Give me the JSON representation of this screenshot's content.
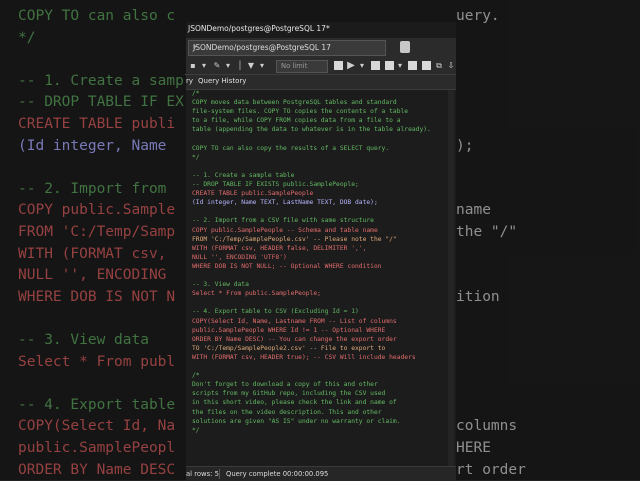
{
  "background_code": {
    "lines": [
      "COPY TO can also c",
      "*/",
      "",
      "-- 1. Create a sampl",
      "-- DROP TABLE IF EX",
      "CREATE TABLE publi",
      "(Id integer, Name ",
      "",
      "-- 2. Import from ",
      "COPY public.Sample",
      "FROM 'C:/Temp/Samp",
      "WITH (FORMAT csv, ",
      "NULL '', ENCODING ",
      "WHERE DOB IS NOT N",
      "",
      "-- 3. View data",
      "Select * From publ",
      "",
      "-- 4. Export table",
      "COPY(Select Id, Na",
      "public.SamplePeopl",
      "ORDER BY Name DESC"
    ],
    "right_lines": [
      "uery.",
      "",
      "",
      "",
      "",
      "",
      ");",
      "",
      "",
      "name",
      "the \"/\"",
      "",
      "",
      "ition",
      "",
      "",
      "",
      "",
      "",
      "columns",
      "HERE",
      "rt order"
    ]
  },
  "window": {
    "title": "JSONDemo/postgres@PostgreSQL 17*",
    "connection": "JSONDemo/postgres@PostgreSQL 17",
    "limit_placeholder": "No limit",
    "tabs": [
      "ry",
      "Query History"
    ]
  },
  "editor": {
    "lines": [
      {
        "text": "/*",
        "c": "g"
      },
      {
        "text": "COPY moves data between PostgreSQL tables and standard",
        "c": "g"
      },
      {
        "text": "file-system files. COPY TO copies the contents of a table",
        "c": "g"
      },
      {
        "text": "to a file, while COPY FROM copies data from a file to a",
        "c": "g"
      },
      {
        "text": "table (appending the data to whatever is in the table already).",
        "c": "g"
      },
      {
        "text": "",
        "c": "g"
      },
      {
        "text": "COPY TO can also copy the results of a SELECT query.",
        "c": "g"
      },
      {
        "text": "*/",
        "c": "g"
      },
      {
        "text": "",
        "c": "g"
      },
      {
        "text": "-- 1. Create a sample table",
        "c": "g"
      },
      {
        "text": "-- DROP TABLE IF EXISTS public.SamplePeople;",
        "c": "g"
      },
      {
        "text": "CREATE TABLE public.SamplePeople",
        "c": "k"
      },
      {
        "text": "(Id integer, Name TEXT, LastName TEXT, DOB date);",
        "c": "t"
      },
      {
        "text": "",
        "c": "g"
      },
      {
        "text": "-- 2. Import from a CSV file with same structure",
        "c": "g"
      },
      {
        "text": "COPY public.SamplePeople -- Schema and table name",
        "c": "k"
      },
      {
        "text": "FROM 'C:/Temp/SamplePeople.csv' -- Please note the \"/\"",
        "c": "s"
      },
      {
        "text": "WITH (FORMAT csv, HEADER false, DELIMITER ',',",
        "c": "k"
      },
      {
        "text": "NULL '', ENCODING 'UTF8')",
        "c": "k"
      },
      {
        "text": "WHERE DOB IS NOT NULL; -- Optional WHERE condition",
        "c": "k"
      },
      {
        "text": "",
        "c": "g"
      },
      {
        "text": "-- 3. View data",
        "c": "g"
      },
      {
        "text": "Select * From public.SamplePeople;",
        "c": "k"
      },
      {
        "text": "",
        "c": "g"
      },
      {
        "text": "-- 4. Export table to CSV (Excluding Id = 1)",
        "c": "g"
      },
      {
        "text": "COPY(Select Id, Name, Lastname FROM -- List of columns",
        "c": "k"
      },
      {
        "text": "public.SamplePeople WHERE Id != 1 -- Optional WHERE",
        "c": "k"
      },
      {
        "text": "ORDER BY Name DESC) -- You can change the export order",
        "c": "k"
      },
      {
        "text": "TO 'C:/Temp/SamplePeople2.csv' -- File to export to",
        "c": "s"
      },
      {
        "text": "WITH (FORMAT csv, HEADER true); -- CSV Will include headers",
        "c": "k"
      },
      {
        "text": "",
        "c": "g"
      },
      {
        "text": "/*",
        "c": "g"
      },
      {
        "text": "Don't forget to download a copy of this and other",
        "c": "g"
      },
      {
        "text": "scripts from my GitHub repo, including the CSV used",
        "c": "g"
      },
      {
        "text": "in this short video, please check the link and name of",
        "c": "g"
      },
      {
        "text": "the files on the video description. This and other",
        "c": "g"
      },
      {
        "text": "solutions are given \"AS IS\" under no warranty or claim.",
        "c": "g"
      },
      {
        "text": "*/",
        "c": "g"
      }
    ]
  },
  "status": {
    "rows": "al rows: 5",
    "message": "Query complete 00:00:00.095"
  }
}
